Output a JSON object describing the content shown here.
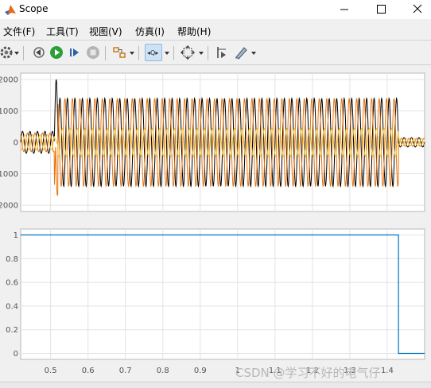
{
  "window": {
    "title": "Scope"
  },
  "menu": [
    "文件(F)",
    "工具(T)",
    "视图(V)",
    "仿真(I)",
    "帮助(H)"
  ],
  "toolbar": {
    "icons": [
      "gear-icon",
      "step-back-icon",
      "run-icon",
      "step-forward-icon",
      "stop-icon",
      "highlight-block-icon",
      "zoom-mode-icon",
      "fit-axes-icon",
      "cursor-measure-icon",
      "style-icon"
    ]
  },
  "plots": {
    "top": {
      "y_ticks": [
        "2000",
        "1000",
        "0",
        "1000",
        "2000"
      ]
    },
    "bottom": {
      "y_ticks": [
        "1",
        "0.8",
        "0.6",
        "0.4",
        "0.2",
        "0"
      ],
      "x_ticks": [
        "0.5",
        "0.6",
        "0.7",
        "0.8",
        "0.9",
        "1",
        "1.1",
        "1.2",
        "1.3",
        "1.4"
      ]
    }
  },
  "chart_data": [
    {
      "type": "line",
      "ylim": [
        -2200,
        2200
      ],
      "xlim": [
        0.42,
        1.5
      ],
      "ticks_x": [
        0.5,
        0.6,
        0.7,
        0.8,
        0.9,
        1.0,
        1.1,
        1.2,
        1.3,
        1.4
      ],
      "ticks_y": [
        2000,
        1000,
        0,
        -1000,
        -2000
      ],
      "grid": true,
      "series": [
        {
          "color": "#000000",
          "segments": [
            {
              "x": [
                0.42,
                0.51
              ],
              "amplitude": 350
            },
            {
              "x": [
                0.51,
                0.52
              ],
              "peak": 2000
            },
            {
              "x": [
                0.52,
                1.43
              ],
              "amplitude": 1400
            },
            {
              "x": [
                1.43,
                1.5
              ],
              "amplitude": 150
            }
          ]
        },
        {
          "color": "#e8740c",
          "segments": [
            {
              "x": [
                0.42,
                0.51
              ],
              "amplitude": 300
            },
            {
              "x": [
                0.51,
                0.52
              ],
              "trough": -1700
            },
            {
              "x": [
                0.52,
                1.43
              ],
              "amplitude": 1400
            },
            {
              "x": [
                1.43,
                1.5
              ],
              "amplitude": 130
            }
          ]
        },
        {
          "color": "#f2c12e",
          "segments": [
            {
              "x": [
                0.42,
                0.51
              ],
              "amplitude": 250
            },
            {
              "x": [
                0.52,
                1.43
              ],
              "amplitude": 450
            },
            {
              "x": [
                1.43,
                1.5
              ],
              "amplitude": 120
            }
          ]
        }
      ]
    },
    {
      "type": "line",
      "xlim": [
        0.42,
        1.5
      ],
      "ylim": [
        -0.05,
        1.05
      ],
      "ticks_x": [
        0.5,
        0.6,
        0.7,
        0.8,
        0.9,
        1.0,
        1.1,
        1.2,
        1.3,
        1.4
      ],
      "ticks_y": [
        1,
        0.8,
        0.6,
        0.4,
        0.2,
        0
      ],
      "grid": true,
      "series": [
        {
          "color": "#0072bd",
          "x": [
            0.42,
            1.43,
            1.43,
            1.5
          ],
          "y": [
            1,
            1,
            0,
            0
          ]
        }
      ]
    }
  ],
  "watermark": "CSDN @学习不好的电气仔"
}
